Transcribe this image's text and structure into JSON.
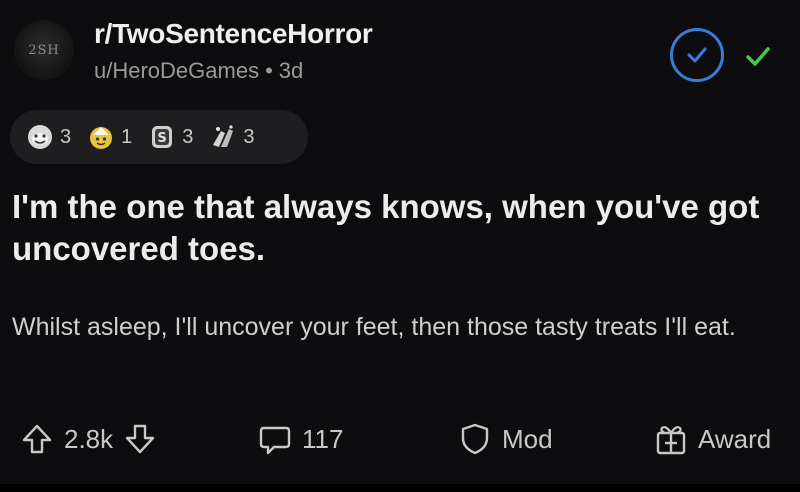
{
  "subreddit": {
    "name": "r/TwoSentenceHorror",
    "avatar_text": "2SH"
  },
  "meta": {
    "author": "u/HeroDeGames",
    "separator": "•",
    "age": "3d"
  },
  "awards": [
    {
      "icon": "wholesome-award-icon",
      "count": "3"
    },
    {
      "icon": "helpful-award-icon",
      "count": "1"
    },
    {
      "icon": "silver-coin-award-icon",
      "count": "3"
    },
    {
      "icon": "hands-award-icon",
      "count": "3"
    }
  ],
  "post": {
    "title": "I'm the one that always knows, when you've got uncovered toes.",
    "body": "Whilst asleep, I'll uncover your feet, then those tasty treats I'll eat."
  },
  "actions": {
    "score": "2.8k",
    "comments": "117",
    "mod_label": "Mod",
    "award_label": "Award"
  },
  "colors": {
    "background": "#0d0d0f",
    "join_ring": "#3a7bd5",
    "check": "#46c84b"
  }
}
